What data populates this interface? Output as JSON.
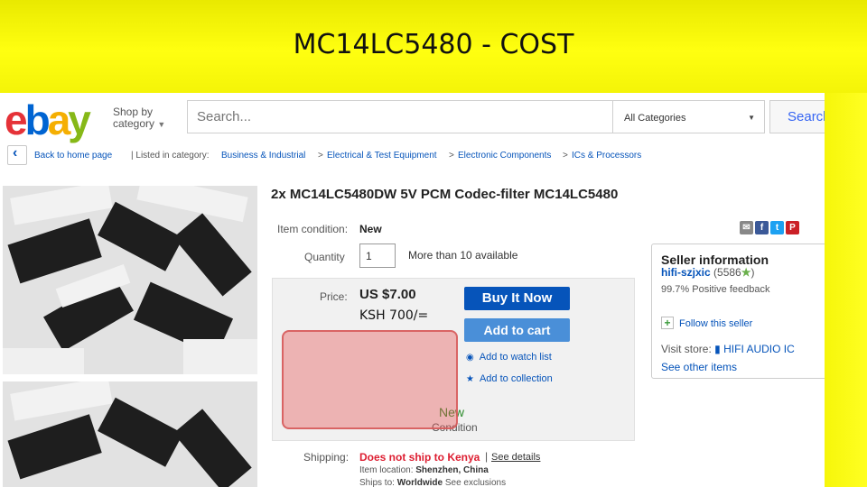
{
  "slide": {
    "title": "MC14LC5480 - COST"
  },
  "header": {
    "logo": [
      "e",
      "b",
      "a",
      "y"
    ],
    "shop_by_line1": "Shop by",
    "shop_by_line2": "category",
    "search_placeholder": "Search...",
    "category_select": "All Categories",
    "search_button": "Search"
  },
  "breadcrumb": {
    "back": "Back to home page",
    "listed": "| Listed in category:",
    "items": [
      "Business & Industrial",
      "Electrical & Test Equipment",
      "Electronic Components",
      "ICs & Processors"
    ],
    "separator": ">"
  },
  "item": {
    "title": "2x MC14LC5480DW 5V PCM Codec-filter MC14LC5480",
    "condition_label": "Item condition:",
    "condition_value": "New",
    "quantity_label": "Quantity",
    "quantity_value": "1",
    "availability": "More than 10 available",
    "price_label": "Price:",
    "price_value": "US $7.00",
    "price_annotation": "KSH 700/=",
    "buy_now": "Buy It Now",
    "add_to_cart": "Add to cart",
    "watch_list": "Add to watch list",
    "collection": "Add to collection",
    "condition_badge": "New",
    "condition_badge_label": "Condition",
    "shipping_label": "Shipping:",
    "shipping_value": "Does not ship to Kenya",
    "shipping_sep": "|",
    "see_details": "See details",
    "location_label": "Item location:",
    "location_value": "Shenzhen, China",
    "ships_to_label": "Ships to:",
    "ships_to_value": "Worldwide",
    "see_exclusions": "See exclusions"
  },
  "seller": {
    "title": "Seller information",
    "name": "hifi-szjxic",
    "score": "(5586",
    "score_close": ")",
    "feedback": "99.7% Positive feedback",
    "follow": "Follow this seller",
    "visit_label": "Visit store:",
    "store_name": "HIFI AUDIO IC",
    "other_items": "See other items"
  },
  "colors": {
    "header_yellow": "#ffff10",
    "ebay_red": "#e53238",
    "ebay_blue": "#0654ba",
    "highlight_red": "#e85050"
  }
}
